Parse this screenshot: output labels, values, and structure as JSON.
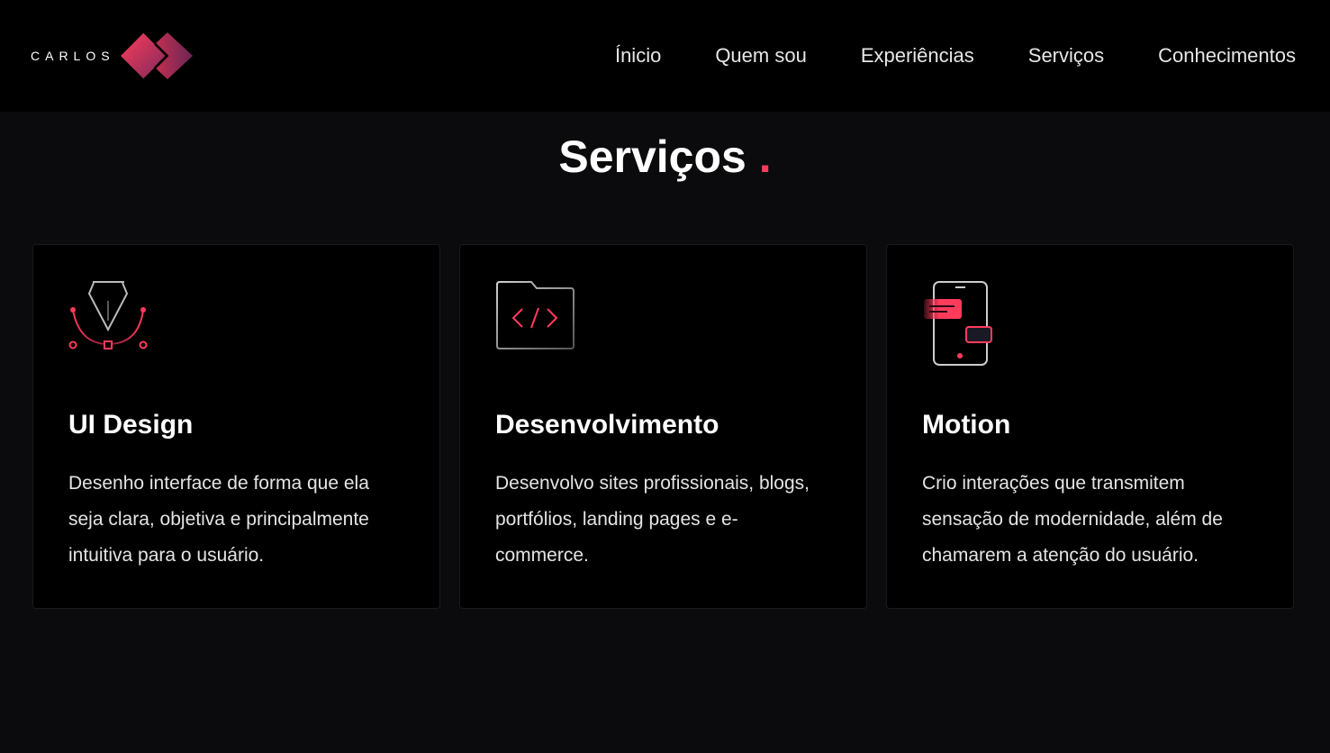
{
  "brand": {
    "name": "CARLOS",
    "accent_color": "#ff3b5c",
    "secondary_color": "#7a2a5a"
  },
  "nav": {
    "items": [
      {
        "label": "Ínicio"
      },
      {
        "label": "Quem sou"
      },
      {
        "label": "Experiências"
      },
      {
        "label": "Serviços"
      },
      {
        "label": "Conhecimentos"
      }
    ]
  },
  "section": {
    "title": "Serviços",
    "title_dot": "."
  },
  "cards": [
    {
      "icon": "pen-tool-icon",
      "title": "UI Design",
      "text": "Desenho interface de forma que ela seja clara, objetiva e principalmente intuitiva para o usuário."
    },
    {
      "icon": "code-folder-icon",
      "title": "Desenvolvimento",
      "text": "Desenvolvo sites profissionais, blogs, portfólios, landing pages e e-commerce."
    },
    {
      "icon": "smartphone-motion-icon",
      "title": "Motion",
      "text": "Crio interações que transmitem sensação de modernidade, além de chamarem a atenção do usuário."
    }
  ]
}
